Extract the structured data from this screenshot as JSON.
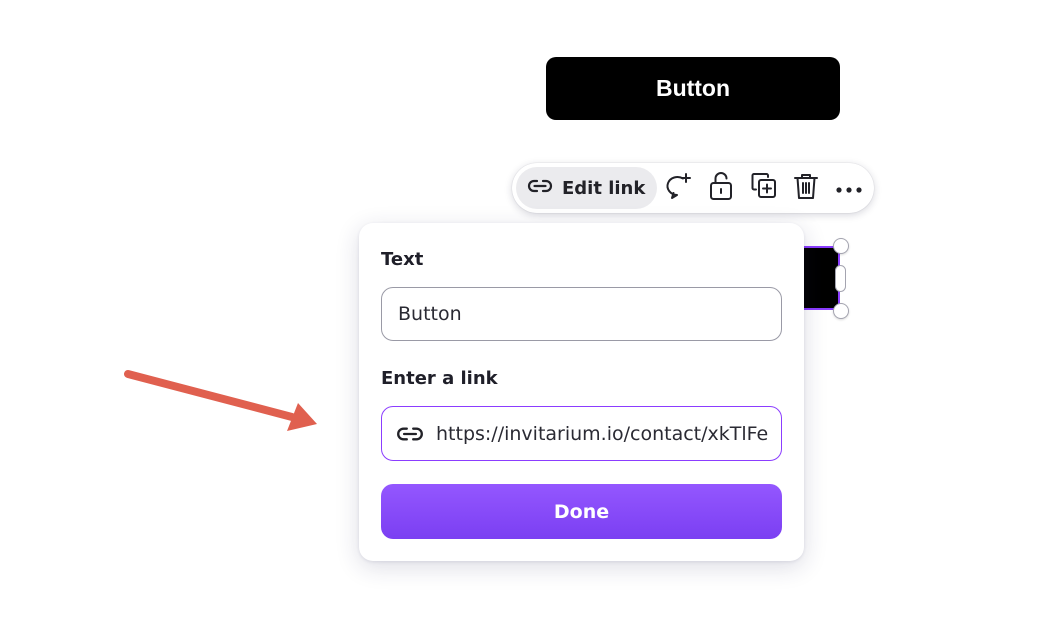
{
  "canvas": {
    "button_label": "Button"
  },
  "toolbar": {
    "edit_link_label": "Edit link",
    "icons": [
      "link-icon",
      "add-comment-icon",
      "unlock-icon",
      "duplicate-icon",
      "trash-icon",
      "more-icon"
    ]
  },
  "popover": {
    "text_label": "Text",
    "text_value": "Button",
    "link_label": "Enter a link",
    "link_value": "https://invitarium.io/contact/xkTlFe",
    "done_label": "Done"
  },
  "colors": {
    "accent": "#8b3dff",
    "done_button": "#8a4dff",
    "annotation_arrow": "#e0604f",
    "canvas_button": "#000000"
  }
}
